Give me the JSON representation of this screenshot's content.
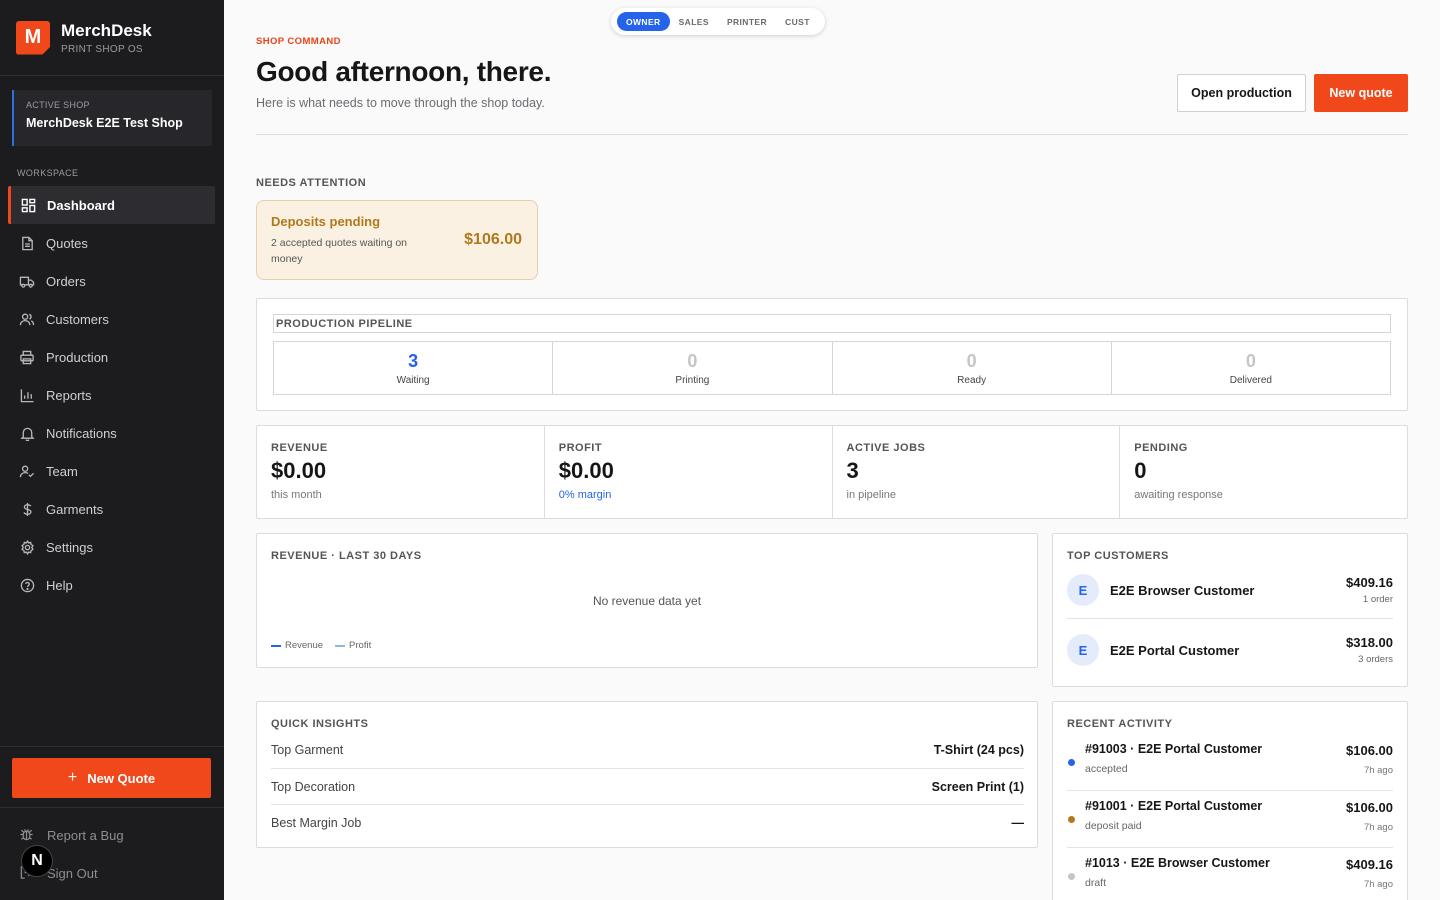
{
  "brand": {
    "title": "MerchDesk",
    "subtitle": "PRINT SHOP OS",
    "logo_letter": "M",
    "accent": "#f0481a"
  },
  "active_shop": {
    "label": "ACTIVE SHOP",
    "name": "MerchDesk E2E Test Shop"
  },
  "sidebar": {
    "section_label": "WORKSPACE",
    "items": [
      {
        "label": "Dashboard",
        "icon": "dashboard-icon",
        "active": true
      },
      {
        "label": "Quotes",
        "icon": "document-icon"
      },
      {
        "label": "Orders",
        "icon": "truck-icon"
      },
      {
        "label": "Customers",
        "icon": "users-icon"
      },
      {
        "label": "Production",
        "icon": "printer-icon"
      },
      {
        "label": "Reports",
        "icon": "bar-chart-icon"
      },
      {
        "label": "Notifications",
        "icon": "bell-icon"
      },
      {
        "label": "Team",
        "icon": "user-check-icon"
      },
      {
        "label": "Garments",
        "icon": "dollar-icon"
      },
      {
        "label": "Settings",
        "icon": "gear-icon"
      },
      {
        "label": "Help",
        "icon": "help-circle-icon"
      }
    ],
    "new_quote_label": "New Quote",
    "footer": {
      "report_bug": "Report a Bug",
      "sign_out": "Sign Out"
    }
  },
  "roles": {
    "items": [
      "OWNER",
      "SALES",
      "PRINTER",
      "CUST"
    ],
    "active": "OWNER",
    "active_color": "#2563eb"
  },
  "header": {
    "eyebrow": "SHOP COMMAND",
    "title": "Good afternoon, there.",
    "subtitle": "Here is what needs to move through the shop today.",
    "open_production_label": "Open production",
    "new_quote_label": "New quote"
  },
  "needs_attention": {
    "label": "NEEDS ATTENTION",
    "card": {
      "title": "Deposits pending",
      "description": "2 accepted quotes waiting on money",
      "amount": "$106.00"
    }
  },
  "pipeline": {
    "title": "PRODUCTION PIPELINE",
    "stages": [
      {
        "count": "3",
        "label": "Waiting"
      },
      {
        "count": "0",
        "label": "Printing"
      },
      {
        "count": "0",
        "label": "Ready"
      },
      {
        "count": "0",
        "label": "Delivered"
      }
    ]
  },
  "stats": [
    {
      "label": "REVENUE",
      "value": "$0.00",
      "note": "this month"
    },
    {
      "label": "PROFIT",
      "value": "$0.00",
      "note": "0% margin"
    },
    {
      "label": "ACTIVE JOBS",
      "value": "3",
      "note": "in pipeline"
    },
    {
      "label": "PENDING",
      "value": "0",
      "note": "awaiting response"
    }
  ],
  "revenue_chart": {
    "title": "REVENUE · LAST 30 DAYS",
    "empty_message": "No revenue data yet",
    "legend": [
      {
        "name": "Revenue",
        "color": "#2563eb"
      },
      {
        "name": "Profit",
        "color": "#8fb6ea"
      }
    ]
  },
  "top_customers": {
    "title": "TOP CUSTOMERS",
    "items": [
      {
        "initial": "E",
        "name": "E2E Browser Customer",
        "amount": "$409.16",
        "orders": "1 order"
      },
      {
        "initial": "E",
        "name": "E2E Portal Customer",
        "amount": "$318.00",
        "orders": "3 orders"
      }
    ]
  },
  "quick_insights": {
    "title": "QUICK INSIGHTS",
    "rows": [
      {
        "label": "Top Garment",
        "value": "T-Shirt (24 pcs)"
      },
      {
        "label": "Top Decoration",
        "value": "Screen Print (1)"
      },
      {
        "label": "Best Margin Job",
        "value": "—"
      }
    ]
  },
  "recent_activity": {
    "title": "RECENT ACTIVITY",
    "items": [
      {
        "title": "#91003 · E2E Portal Customer",
        "status": "accepted",
        "amount": "$106.00",
        "ago": "7h ago",
        "color": "#2563eb"
      },
      {
        "title": "#91001 · E2E Portal Customer",
        "status": "deposit paid",
        "amount": "$106.00",
        "ago": "7h ago",
        "color": "#b07a1c"
      },
      {
        "title": "#1013 · E2E Browser Customer",
        "status": "draft",
        "amount": "$409.16",
        "ago": "7h ago",
        "color": "#c4c4c9"
      }
    ]
  },
  "overlay_badge": "N"
}
